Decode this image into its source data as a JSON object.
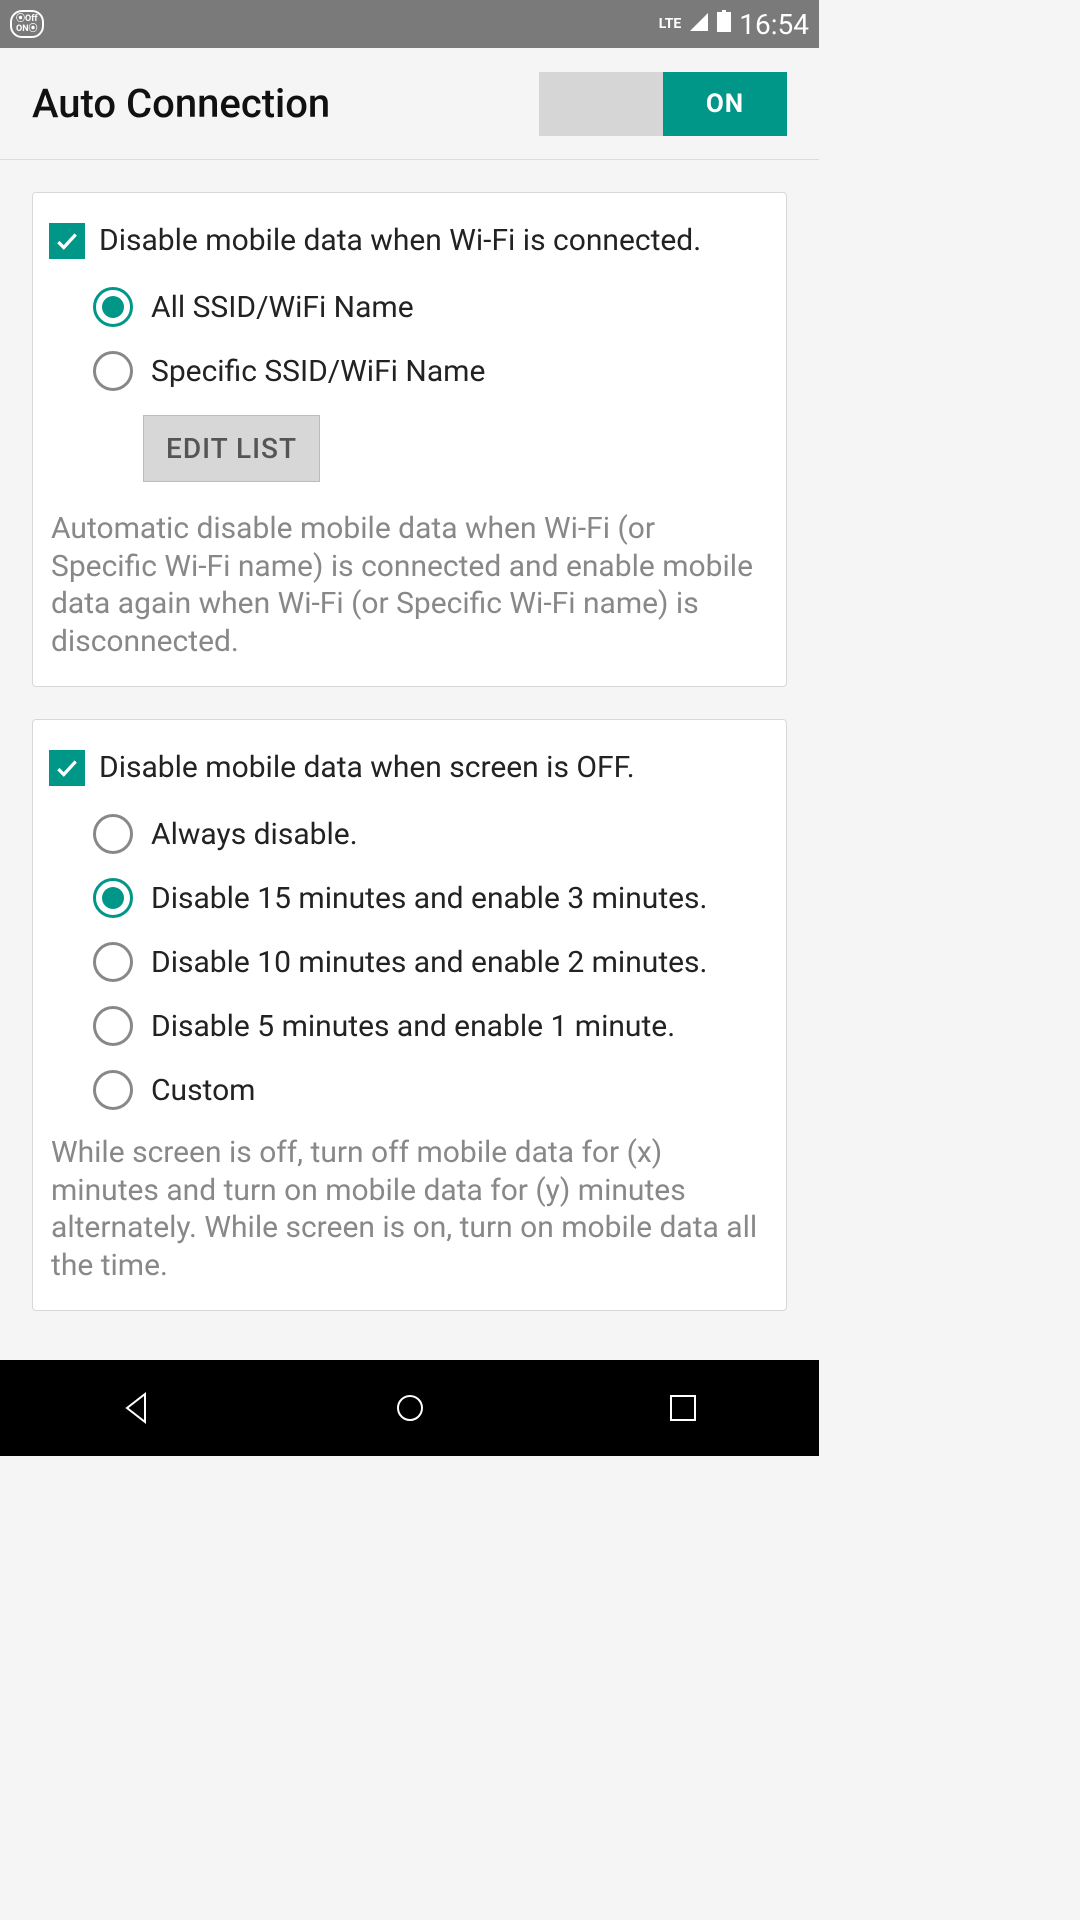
{
  "status_bar": {
    "toggle_text": "Off\nON",
    "lte": "LTE",
    "time": "16:54"
  },
  "header": {
    "title": "Auto Connection",
    "switch_label": "ON"
  },
  "card1": {
    "checkbox_label": "Disable mobile data when Wi-Fi is connected.",
    "options": {
      "all": "All SSID/WiFi Name",
      "specific": "Specific SSID/WiFi Name"
    },
    "edit_button": "EDIT LIST",
    "description": "Automatic disable mobile data when Wi-Fi (or Specific Wi-Fi name) is connected and enable mobile data again when Wi-Fi (or Specific Wi-Fi name) is disconnected."
  },
  "card2": {
    "checkbox_label": "Disable mobile data when screen is OFF.",
    "options": {
      "always": "Always disable.",
      "d15e3": "Disable 15 minutes and enable 3 minutes.",
      "d10e2": "Disable 10 minutes and enable 2 minutes.",
      "d5e1": "Disable 5 minutes and enable 1 minute.",
      "custom": "Custom"
    },
    "description": "While screen is off, turn off mobile data for (x) minutes and turn on mobile data for (y) minutes alternately. While screen is on, turn on mobile data all the time."
  }
}
